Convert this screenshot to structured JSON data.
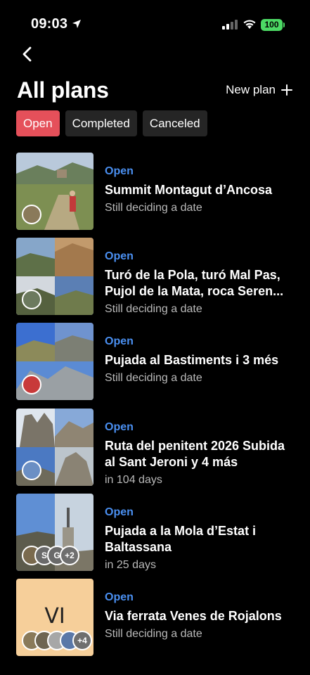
{
  "status_bar": {
    "time": "09:03",
    "battery": "100"
  },
  "header": {
    "title": "All plans",
    "new_plan_label": "New plan"
  },
  "tabs": [
    {
      "label": "Open",
      "active": true
    },
    {
      "label": "Completed",
      "active": false
    },
    {
      "label": "Canceled",
      "active": false
    }
  ],
  "plans": [
    {
      "status": "Open",
      "title": "Summit Montagut d’Ancosa",
      "subtitle": "Still deciding a date",
      "avatars": []
    },
    {
      "status": "Open",
      "title": "Turó de la Pola, turó Mal Pas, Pujol de la Mata, roca Seren...",
      "subtitle": "Still deciding a date",
      "avatars": []
    },
    {
      "status": "Open",
      "title": "Pujada al Bastiments i 3 més",
      "subtitle": "Still deciding a date",
      "avatars": []
    },
    {
      "status": "Open",
      "title": "Ruta del penitent 2026 Subida al Sant Jeroni y 4 más",
      "subtitle": "in 104 days",
      "avatars": []
    },
    {
      "status": "Open",
      "title": "Pujada a la Mola d’Estat i Baltassana",
      "subtitle": "in 25 days",
      "avatars": [
        "S",
        "G",
        "+2"
      ]
    },
    {
      "status": "Open",
      "title": "Via ferrata Venes de Rojalons",
      "subtitle": "Still deciding a date",
      "thumb_text": "VI",
      "avatars": [
        "+4"
      ]
    }
  ],
  "colors": {
    "accent_open": "#4a8ff0",
    "active_tab": "#e5505a",
    "tab_bg": "#252525",
    "battery": "#4cd964",
    "placeholder_thumb": "#f6cf9a"
  }
}
